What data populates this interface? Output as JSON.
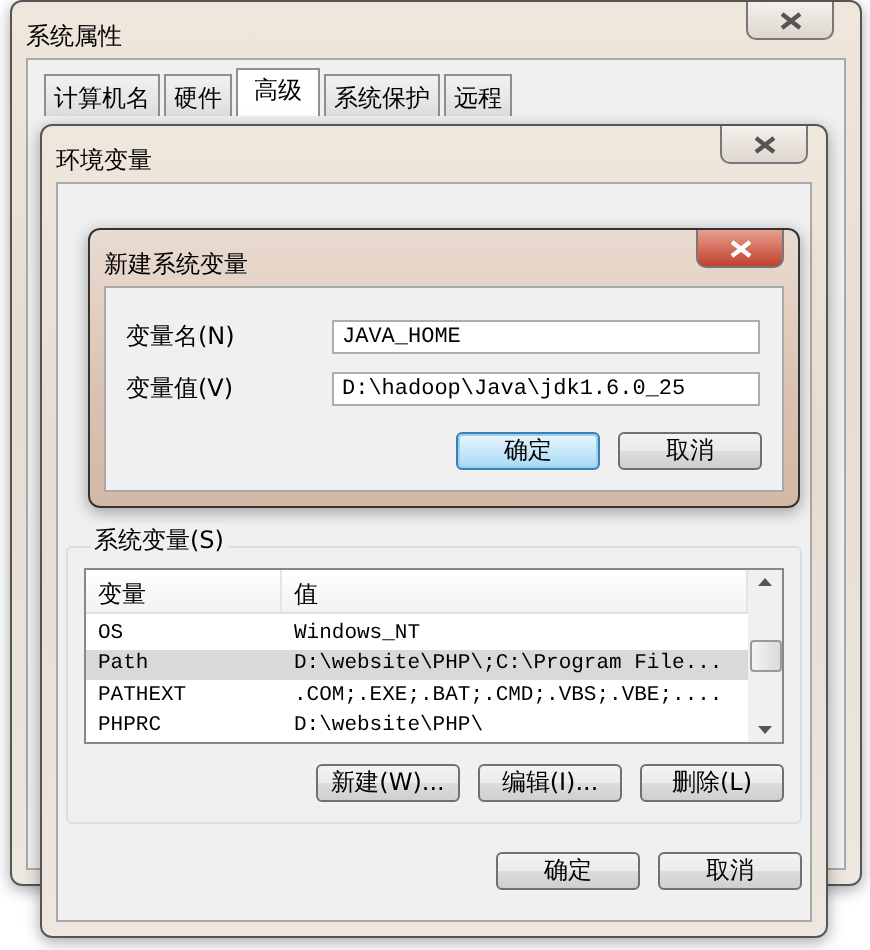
{
  "system_properties": {
    "title": "系统属性",
    "tabs": [
      {
        "label": "计算机名",
        "selected": false
      },
      {
        "label": "硬件",
        "selected": false
      },
      {
        "label": "高级",
        "selected": true
      },
      {
        "label": "系统保护",
        "selected": false
      },
      {
        "label": "远程",
        "selected": false
      }
    ]
  },
  "environment_variables": {
    "title": "环境变量",
    "system_variables": {
      "label": "系统变量(S)",
      "columns": [
        "变量",
        "值"
      ],
      "rows": [
        {
          "name": "OS",
          "value": "Windows_NT",
          "selected": false
        },
        {
          "name": "Path",
          "value": "D:\\website\\PHP\\;C:\\Program File...",
          "selected": true
        },
        {
          "name": "PATHEXT",
          "value": ".COM;.EXE;.BAT;.CMD;.VBS;.VBE;....",
          "selected": false
        },
        {
          "name": "PHPRC",
          "value": "D:\\website\\PHP\\",
          "selected": false
        }
      ],
      "buttons": [
        "新建(W)...",
        "编辑(I)...",
        "删除(L)"
      ]
    },
    "buttons": [
      "确定",
      "取消"
    ]
  },
  "new_variable_dialog": {
    "title": "新建系统变量",
    "fields": [
      {
        "label": "变量名(N)",
        "value": "JAVA_HOME"
      },
      {
        "label": "变量值(V)",
        "value": "D:\\hadoop\\Java\\jdk1.6.0_25"
      }
    ],
    "buttons": [
      {
        "label": "确定",
        "default": true
      },
      {
        "label": "取消",
        "default": false
      }
    ]
  }
}
